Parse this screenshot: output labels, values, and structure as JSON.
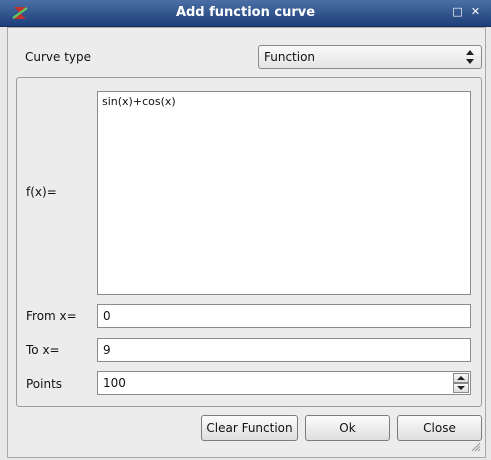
{
  "window": {
    "title": "Add function curve",
    "maximize_glyph": "□",
    "close_glyph": "✕"
  },
  "curve_type": {
    "label": "Curve type",
    "value": "Function",
    "options": [
      "Function"
    ]
  },
  "function": {
    "label": "f(x)=",
    "value": "sin(x)+cos(x)"
  },
  "from": {
    "label": "From x=",
    "value": "0"
  },
  "to": {
    "label": "To x=",
    "value": "9"
  },
  "points": {
    "label": "Points",
    "value": "100"
  },
  "buttons": {
    "clear": "Clear Function",
    "ok": "Ok",
    "close": "Close"
  },
  "icons": {
    "app": "qtiplot-app-icon",
    "maximize": "maximize-icon",
    "close": "close-icon",
    "combo_arrow": "up-down-arrows-icon",
    "spin_up": "spin-up-arrow-icon",
    "spin_down": "spin-down-arrow-icon",
    "resize": "resize-grip-icon"
  }
}
